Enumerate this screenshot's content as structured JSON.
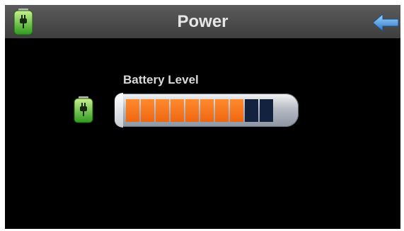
{
  "header": {
    "title": "Power",
    "left_icon": "battery-plug-icon",
    "right_icon": "back-arrow-icon"
  },
  "battery": {
    "label": "Battery Level",
    "icon": "battery-plug-icon",
    "level_fraction": 0.8,
    "segments_total": 10,
    "segments_filled": 8
  },
  "colors": {
    "background": "#000000",
    "header": "#4a4a4a",
    "title_text": "#e6e6e6",
    "segment_on": "#f26a16",
    "segment_off": "#13233f",
    "battery_green": "#58c43c",
    "arrow_blue": "#3f8ed8"
  }
}
